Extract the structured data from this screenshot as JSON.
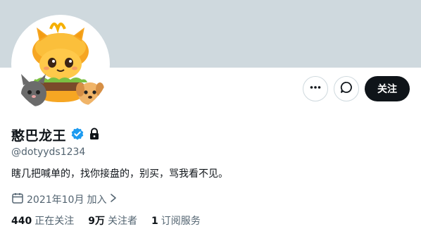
{
  "profile": {
    "display_name": "憨巴龙王",
    "handle": "@dotyyds1234",
    "bio": "瞎几把喊单的，找你接盘的，别买，骂我看不见。",
    "joined": "2021年10月",
    "join_suffix": "加入"
  },
  "actions": {
    "more_icon": "more-horizontal-icon",
    "message_icon": "message-bubble-icon",
    "follow_label": "关注"
  },
  "badges": {
    "verified_icon": "verified-badge-icon",
    "protected_icon": "lock-icon"
  },
  "stats": [
    {
      "value": "440",
      "label": "正在关注"
    },
    {
      "value": "9万",
      "label": "关注者"
    },
    {
      "value": "1",
      "label": "订阅服务"
    }
  ],
  "colors": {
    "banner": "#cfd9de",
    "verified": "#1d9bf0",
    "follow_button": "#0f1419"
  }
}
